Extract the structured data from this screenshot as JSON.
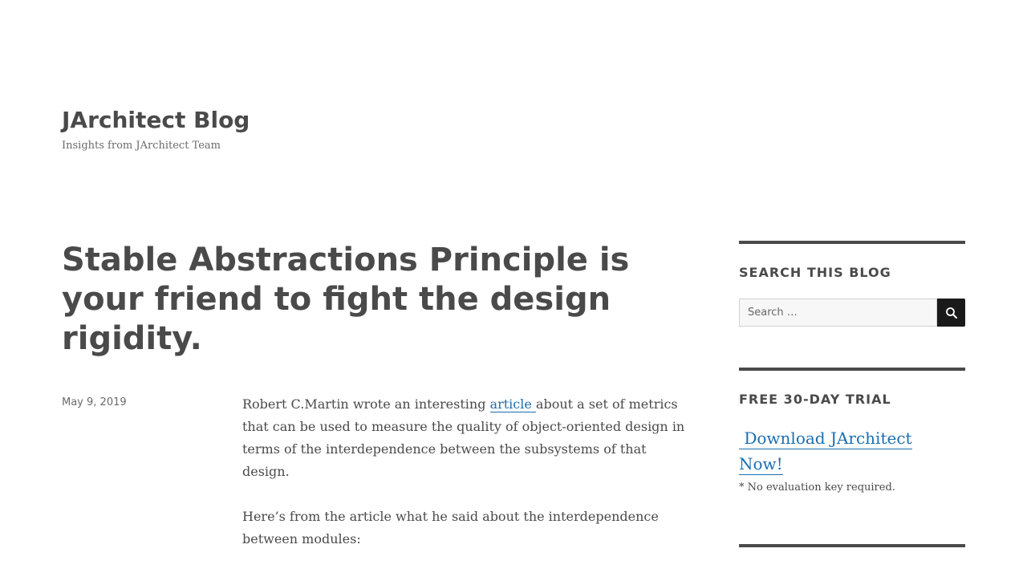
{
  "site": {
    "title": "JArchitect Blog",
    "description": "Insights from JArchitect Team"
  },
  "post": {
    "title": "Stable Abstractions Principle is your friend to fight the design rigidity.",
    "date": "May 9, 2019",
    "paragraph1_before_link": "Robert C.Martin wrote an interesting ",
    "paragraph1_link": "article ",
    "paragraph1_after_link": "about a set of metrics that can be used to measure the quality of object-oriented design in terms of the interdependence between the subsystems of that design.",
    "paragraph2": "Here’s from the article what he said about the interdependence between modules:"
  },
  "sidebar": {
    "search": {
      "title": "SEARCH THIS BLOG",
      "placeholder": "Search …",
      "button_icon": "search-icon"
    },
    "trial": {
      "title": "FREE 30-DAY TRIAL",
      "link_line1": "Download JArchitect",
      "link_line2": "Now!",
      "note": "* No evaluation key required."
    }
  },
  "colors": {
    "text": "#4a4a4a",
    "link": "#1a6fb0",
    "button_bg": "#1a1a1a"
  }
}
